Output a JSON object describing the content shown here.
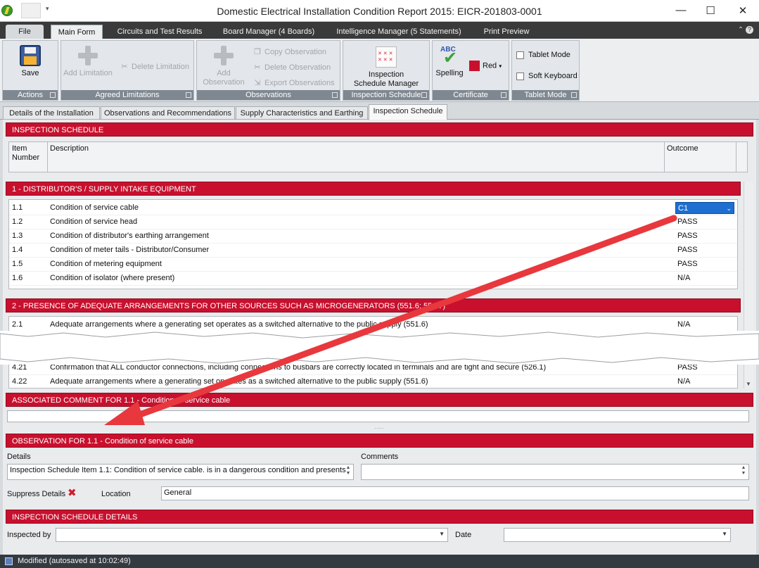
{
  "window": {
    "title": "Domestic Electrical Installation Condition Report 2015: EICR-201803-0001",
    "minimize": "—",
    "maximize": "☐",
    "close": "✕"
  },
  "ribbon_tabs": [
    "File",
    "Main Form",
    "Circuits and Test Results",
    "Board Manager (4 Boards)",
    "Intelligence Manager (5 Statements)",
    "Print Preview"
  ],
  "ribbon": {
    "actions": {
      "label": "Actions",
      "save": "Save"
    },
    "limitations": {
      "label": "Agreed Limitations",
      "add": "Add Limitation",
      "delete": "Delete Limitation"
    },
    "observations": {
      "label": "Observations",
      "add_line1": "Add",
      "add_line2": "Observation",
      "copy": "Copy Observation",
      "delete": "Delete Observation",
      "export": "Export Observations"
    },
    "inspection_schedule": {
      "label": "Inspection Schedule",
      "manager_line1": "Inspection",
      "manager_line2": "Schedule Manager"
    },
    "certificate": {
      "label": "Certificate",
      "spelling": "Spelling",
      "color_name": "Red",
      "color_hex": "#c8102e"
    },
    "tablet_mode": {
      "label": "Tablet Mode",
      "tablet": "Tablet Mode",
      "keyboard": "Soft Keyboard"
    }
  },
  "doc_tabs": [
    "Details of the Installation",
    "Observations and Recommendations",
    "Supply Characteristics and Earthing",
    "Inspection Schedule"
  ],
  "schedule": {
    "header": "INSPECTION SCHEDULE",
    "col_item_line1": "Item",
    "col_item_line2": "Number",
    "col_desc": "Description",
    "col_outcome": "Outcome"
  },
  "section1": {
    "header": "1 - DISTRIBUTOR'S / SUPPLY INTAKE EQUIPMENT",
    "rows": [
      {
        "num": "1.1",
        "desc": "Condition of service cable",
        "outcome": "C1"
      },
      {
        "num": "1.2",
        "desc": "Condition of service head",
        "outcome": "PASS"
      },
      {
        "num": "1.3",
        "desc": "Condition of distributor's earthing arrangement",
        "outcome": "PASS"
      },
      {
        "num": "1.4",
        "desc": "Condition of meter tails - Distributor/Consumer",
        "outcome": "PASS"
      },
      {
        "num": "1.5",
        "desc": "Condition of metering equipment",
        "outcome": "PASS"
      },
      {
        "num": "1.6",
        "desc": "Condition of isolator (where present)",
        "outcome": "N/A"
      }
    ]
  },
  "section2": {
    "header": "2 - PRESENCE OF ADEQUATE ARRANGEMENTS FOR OTHER SOURCES SUCH AS MICROGENERATORS (551.6; 551.7)",
    "rows": [
      {
        "num": "2.1",
        "desc": "Adequate arrangements where a generating set operates as a switched alternative to the public supply (551.6)",
        "outcome": "N/A"
      }
    ]
  },
  "section4": {
    "rows": [
      {
        "num": "4.21",
        "desc": "Confirmation that ALL conductor connections, including connections to busbars are correctly located in terminals and are tight and secure (526.1)",
        "outcome": "PASS"
      },
      {
        "num": "4.22",
        "desc": "Adequate arrangements where a generating set operates as a switched alternative to the public supply (551.6)",
        "outcome": "N/A"
      }
    ]
  },
  "comment": {
    "header": "ASSOCIATED COMMENT FOR 1.1 - Condition of service cable",
    "value": ""
  },
  "observation": {
    "header": "OBSERVATION FOR 1.1 - Condition of service cable",
    "details_label": "Details",
    "details_value": "Inspection Schedule Item 1.1: Condition of service cable. is in a dangerous condition and presents",
    "comments_label": "Comments",
    "comments_value": "",
    "suppress_label": "Suppress Details",
    "location_label": "Location",
    "location_value": "General"
  },
  "schedule_details": {
    "header": "INSPECTION SCHEDULE DETAILS",
    "inspected_by_label": "Inspected by",
    "inspected_by_value": "",
    "date_label": "Date",
    "date_value": ""
  },
  "status": {
    "text": "Modified (autosaved at 10:02:49)"
  }
}
